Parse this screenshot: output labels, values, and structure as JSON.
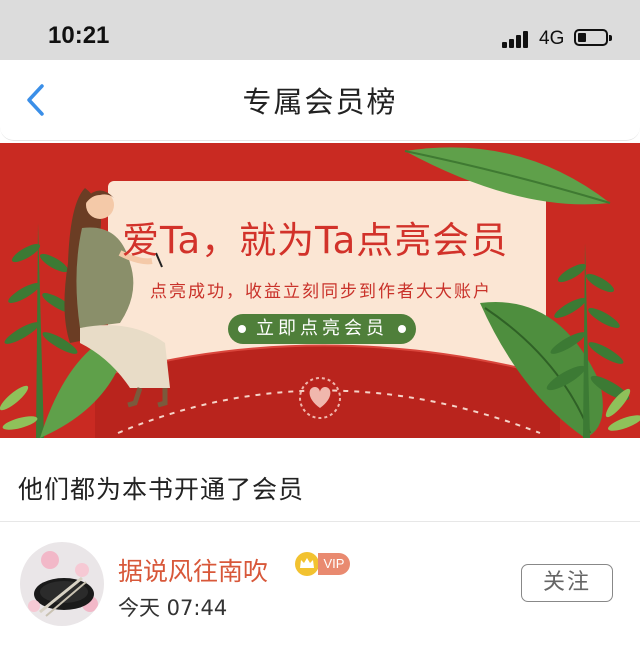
{
  "status_bar": {
    "time": "10:21",
    "network": "4G"
  },
  "nav": {
    "title": "专属会员榜"
  },
  "banner": {
    "headline": "爱Ta，就为Ta点亮会员",
    "subtitle": "点亮成功，收益立刻同步到作者大大账户",
    "cta_label": "立即点亮会员"
  },
  "section": {
    "title": "他们都为本书开通了会员"
  },
  "members": [
    {
      "name": "据说风往南吹",
      "badge": "VIP",
      "time": "今天 07:44",
      "follow_label": "关注"
    }
  ],
  "colors": {
    "banner_red": "#c92a22",
    "card_cream": "#fbe6d4",
    "cta_green": "#4f7f3a",
    "member_name": "#d8583a",
    "back_blue": "#3b8fe8"
  },
  "icons": [
    "signal-icon",
    "battery-icon",
    "back-arrow-icon",
    "crown-icon",
    "heart-logo-icon"
  ]
}
